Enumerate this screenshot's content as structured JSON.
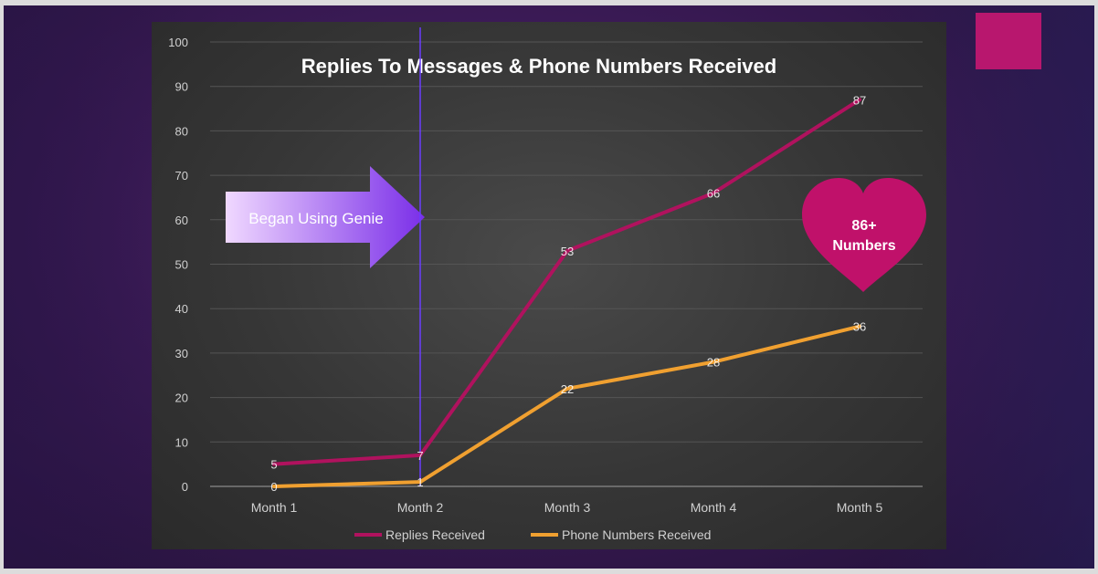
{
  "chart_data": {
    "type": "line",
    "title": "Replies To Messages & Phone Numbers Received",
    "categories": [
      "Month 1",
      "Month 2",
      "Month 3",
      "Month 4",
      "Month 5"
    ],
    "ylim": [
      0,
      100
    ],
    "yticks": [
      0,
      10,
      20,
      30,
      40,
      50,
      60,
      70,
      80,
      90,
      100
    ],
    "grid": true,
    "legend_position": "bottom",
    "series": [
      {
        "name": "Replies Received",
        "values": [
          5,
          7,
          53,
          66,
          87
        ],
        "color": "#b0125e"
      },
      {
        "name": "Phone Numbers Received",
        "values": [
          0,
          1,
          22,
          28,
          36
        ],
        "color": "#f0a030"
      }
    ],
    "data_labels": {
      "Replies Received": [
        "5",
        "7",
        "53",
        "66",
        "87"
      ],
      "Phone Numbers Received": [
        "0",
        "1",
        "22",
        "28",
        "36"
      ]
    },
    "annotations": {
      "arrow_text": "Began Using Genie",
      "marker_category": "Month 2",
      "heart_line1": "86+",
      "heart_line2": "Numbers"
    }
  },
  "colors": {
    "slide_background": "#3a1a55",
    "plot_background": "#3c3c3c",
    "accent_square": "#b8176e",
    "heart": "#c0116a",
    "arrow_start": "#f0d8ff",
    "arrow_end": "#7a2ee8",
    "marker_line": "#6b3dff",
    "text": "#ffffff",
    "axis_text": "#d0d0d0"
  }
}
